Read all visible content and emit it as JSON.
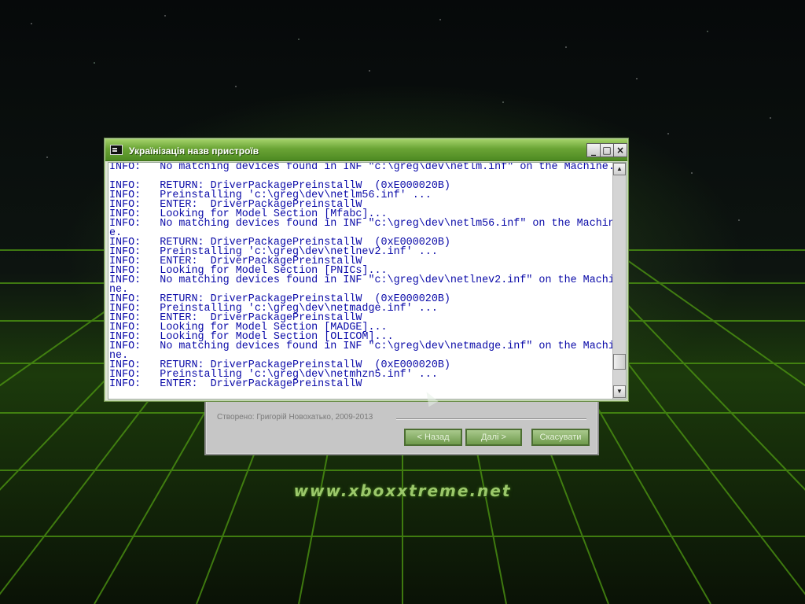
{
  "window": {
    "title": "Українізація назв пристроїв",
    "log_lines": [
      "INFO:   No matching devices found in INF \"c:\\greg\\dev\\netlm.inf\" on the Machine.",
      "",
      "INFO:   RETURN: DriverPackagePreinstallW  (0xE000020B)",
      "INFO:   Preinstalling 'c:\\greg\\dev\\netlm56.inf' ...",
      "INFO:   ENTER:  DriverPackagePreinstallW",
      "INFO:   Looking for Model Section [Mfabc]...",
      "INFO:   No matching devices found in INF \"c:\\greg\\dev\\netlm56.inf\" on the Machin",
      "e.",
      "INFO:   RETURN: DriverPackagePreinstallW  (0xE000020B)",
      "INFO:   Preinstalling 'c:\\greg\\dev\\netlnev2.inf' ...",
      "INFO:   ENTER:  DriverPackagePreinstallW",
      "INFO:   Looking for Model Section [PNICs]...",
      "INFO:   No matching devices found in INF \"c:\\greg\\dev\\netlnev2.inf\" on the Machi",
      "ne.",
      "INFO:   RETURN: DriverPackagePreinstallW  (0xE000020B)",
      "INFO:   Preinstalling 'c:\\greg\\dev\\netmadge.inf' ...",
      "INFO:   ENTER:  DriverPackagePreinstallW",
      "INFO:   Looking for Model Section [MADGE]...",
      "INFO:   Looking for Model Section [OLICOM]...",
      "INFO:   No matching devices found in INF \"c:\\greg\\dev\\netmadge.inf\" on the Machi",
      "ne.",
      "INFO:   RETURN: DriverPackagePreinstallW  (0xE000020B)",
      "INFO:   Preinstalling 'c:\\greg\\dev\\netmhzn5.inf' ...",
      "INFO:   ENTER:  DriverPackagePreinstallW"
    ],
    "scroll_position": 0.92
  },
  "installer": {
    "credit": "Створено: Григорій Новохатько, 2009-2013",
    "back_label": "< Назад",
    "next_label": "Далі >",
    "cancel_label": "Скасувати"
  },
  "background": {
    "site_url": "www.xboxxtreme.net"
  },
  "colors": {
    "log_text": "#0a0aa8",
    "titlebar": "#6aa435"
  },
  "icons": {
    "app": "console-icon",
    "minimize": "minimize-icon",
    "maximize": "maximize-icon",
    "close": "close-icon",
    "scroll_up": "arrow-up-icon",
    "scroll_down": "arrow-down-icon"
  }
}
